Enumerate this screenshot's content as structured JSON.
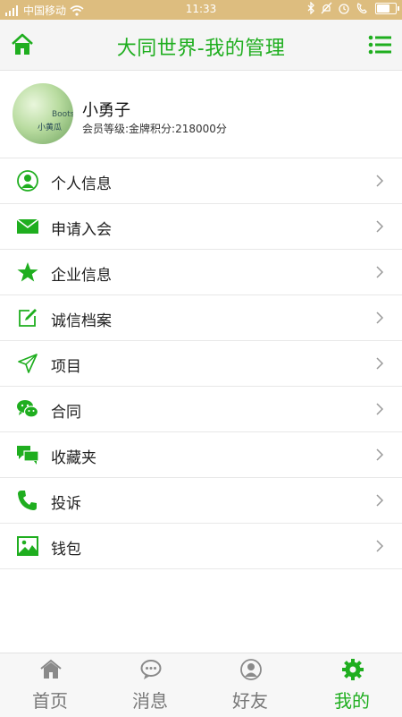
{
  "status_bar": {
    "carrier": "中国移动",
    "time": "11:33",
    "battery_level": 0.75
  },
  "header": {
    "title": "大同世界-我的管理",
    "accent_color": "#1fae1f"
  },
  "profile": {
    "name": "小勇子",
    "level_text": "会员等级:金牌积分:218000分",
    "avatar_text_1": "Boots",
    "avatar_text_2": "小黄瓜"
  },
  "menu": {
    "items": [
      {
        "label": "个人信息",
        "icon": "user-icon"
      },
      {
        "label": "申请入会",
        "icon": "envelope-icon"
      },
      {
        "label": "企业信息",
        "icon": "star-icon"
      },
      {
        "label": "诚信档案",
        "icon": "edit-icon"
      },
      {
        "label": "项目",
        "icon": "send-icon"
      },
      {
        "label": "合同",
        "icon": "wechat-icon"
      },
      {
        "label": "收藏夹",
        "icon": "chat-bubbles-icon"
      },
      {
        "label": "投诉",
        "icon": "phone-icon"
      },
      {
        "label": "钱包",
        "icon": "image-icon"
      }
    ]
  },
  "tabbar": {
    "tabs": [
      {
        "label": "首页",
        "icon": "home-icon",
        "active": false
      },
      {
        "label": "消息",
        "icon": "message-icon",
        "active": false
      },
      {
        "label": "好友",
        "icon": "friend-icon",
        "active": false
      },
      {
        "label": "我的",
        "icon": "gear-icon",
        "active": true
      }
    ]
  }
}
